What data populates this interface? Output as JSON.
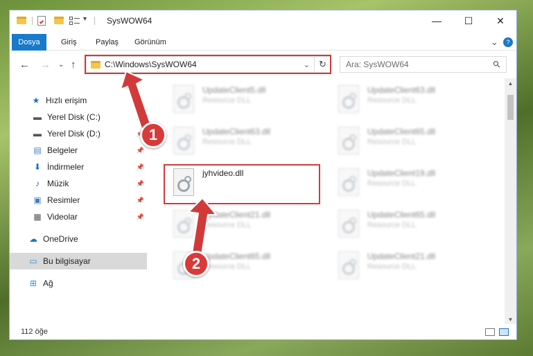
{
  "window": {
    "title": "SysWOW64",
    "minimize": "—",
    "maximize": "☐",
    "close": "✕"
  },
  "ribbon": {
    "tabs": [
      "Dosya",
      "Giriş",
      "Paylaş",
      "Görünüm"
    ],
    "expand": "⌄",
    "help": "?"
  },
  "nav": {
    "back": "←",
    "forward": "→",
    "recent": "⌄",
    "up": "↑",
    "address": "C:\\Windows\\SysWOW64",
    "address_dropdown": "⌄",
    "refresh": "↻",
    "search_placeholder": "Ara: SysWOW64",
    "search_icon": "⚲"
  },
  "sidebar": {
    "items": [
      {
        "label": "Hızlı erişim",
        "icon": "star-icon",
        "glyph": "★",
        "color": "#1e6fc7"
      },
      {
        "label": "Yerel Disk (C:)",
        "icon": "drive-icon",
        "glyph": "▬",
        "color": "#555555"
      },
      {
        "label": "Yerel Disk (D:)",
        "icon": "drive-icon",
        "glyph": "▬",
        "color": "#555555"
      },
      {
        "label": "Belgeler",
        "icon": "documents-icon",
        "glyph": "▤",
        "color": "#4a7fc0"
      },
      {
        "label": "İndirmeler",
        "icon": "download-icon",
        "glyph": "⬇",
        "color": "#1e6fc7"
      },
      {
        "label": "Müzik",
        "icon": "music-icon",
        "glyph": "♪",
        "color": "#1e6fc7"
      },
      {
        "label": "Resimler",
        "icon": "pictures-icon",
        "glyph": "▣",
        "color": "#3d7fbf"
      },
      {
        "label": "Videolar",
        "icon": "videos-icon",
        "glyph": "▦",
        "color": "#555555"
      },
      {
        "label": "OneDrive",
        "icon": "cloud-icon",
        "glyph": "☁",
        "color": "#1e6fc7"
      },
      {
        "label": "Bu bilgisayar",
        "icon": "computer-icon",
        "glyph": "▭",
        "color": "#3b8bd0"
      },
      {
        "label": "Ağ",
        "icon": "network-icon",
        "glyph": "⊞",
        "color": "#3b8bd0"
      }
    ],
    "pin_glyph": "📌"
  },
  "files": [
    {
      "name": "UpdateClient5.dll",
      "type": "Resource DLL",
      "blurred": true
    },
    {
      "name": "UpdateClient63.dll",
      "type": "Resource DLL",
      "blurred": true
    },
    {
      "name": "UpdateClient63.dll",
      "type": "Resource DLL",
      "blurred": true
    },
    {
      "name": "UpdateClient65.dll",
      "type": "Resource DLL",
      "blurred": true
    },
    {
      "name": "jyhvideo.dll",
      "type": "",
      "blurred": false
    },
    {
      "name": "UpdateClient19.dll",
      "type": "Resource DLL",
      "blurred": true
    },
    {
      "name": "UpdateClient21.dll",
      "type": "Resource DLL",
      "blurred": true
    },
    {
      "name": "UpdateClient65.dll",
      "type": "Resource DLL",
      "blurred": true
    },
    {
      "name": "UpdateClient65.dll",
      "type": "Resource DLL",
      "blurred": true
    },
    {
      "name": "UpdateClient21.dll",
      "type": "Resource DLL",
      "blurred": true
    }
  ],
  "status": {
    "count": "112 öğe"
  },
  "annotations": {
    "badge1": "1",
    "badge2": "2",
    "color": "#d23a3a"
  }
}
